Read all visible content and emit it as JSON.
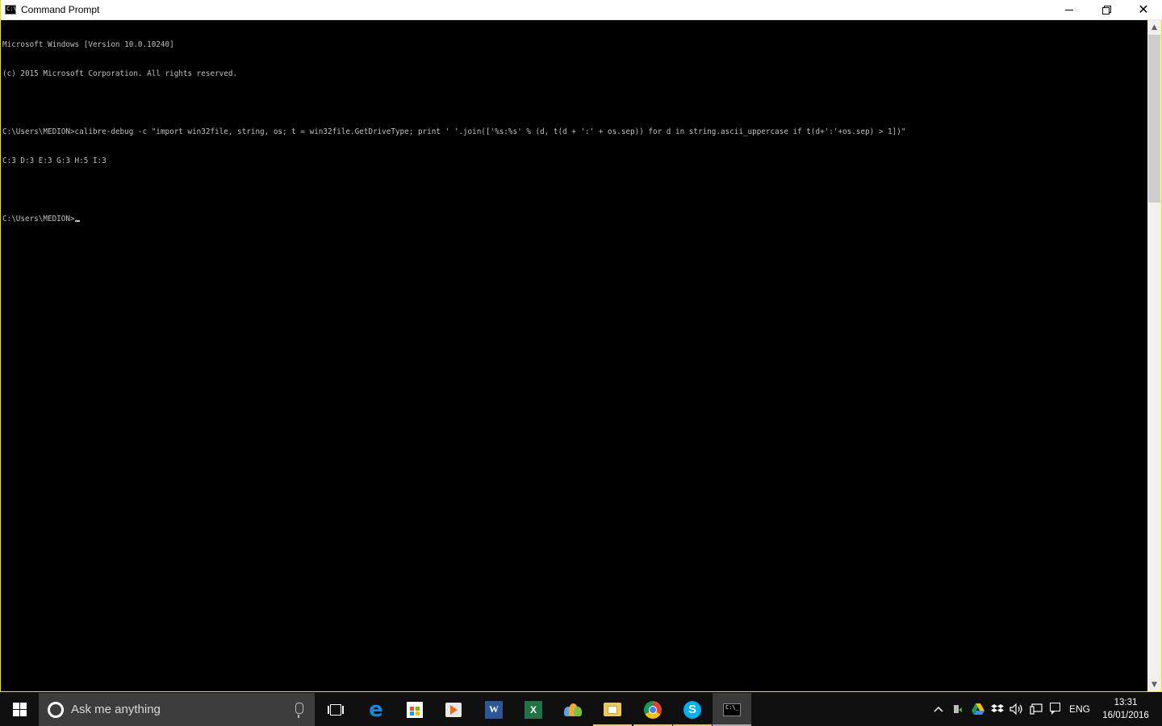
{
  "window": {
    "title": "Command Prompt",
    "controls": {
      "minimize": "minimize",
      "restore": "restore",
      "close": "close"
    }
  },
  "console": {
    "lines": [
      "Microsoft Windows [Version 10.0.10240]",
      "(c) 2015 Microsoft Corporation. All rights reserved.",
      "",
      "C:\\Users\\MEDION>calibre-debug -c \"import win32file, string, os; t = win32file.GetDriveType; print ' '.join(['%s:%s' % (d, t(d + ':' + os.sep)) for d in string.ascii_uppercase if t(d+':'+os.sep) > 1])\"",
      "C:3 D:3 E:3 G:3 H:5 I:3",
      "",
      "C:\\Users\\MEDION>"
    ]
  },
  "taskbar": {
    "search_placeholder": "Ask me anything",
    "pinned": [
      {
        "name": "task-view",
        "running": false
      },
      {
        "name": "edge",
        "running": false
      },
      {
        "name": "store",
        "running": false
      },
      {
        "name": "media",
        "running": false
      },
      {
        "name": "word",
        "label": "W",
        "running": false
      },
      {
        "name": "excel",
        "label": "X",
        "running": false
      },
      {
        "name": "people",
        "running": false
      },
      {
        "name": "file-explorer",
        "running": true
      },
      {
        "name": "chrome",
        "running": true
      },
      {
        "name": "skype",
        "label": "S",
        "running": true
      },
      {
        "name": "command-prompt",
        "running": true,
        "active": true
      }
    ],
    "tray": {
      "language": "ENG",
      "time": "13:31",
      "date": "16/01/2016"
    }
  },
  "colors": {
    "console_bg": "#000000",
    "console_fg": "#c0c0c0",
    "window_border": "#f2e400",
    "taskbar_bg": "#101010"
  }
}
